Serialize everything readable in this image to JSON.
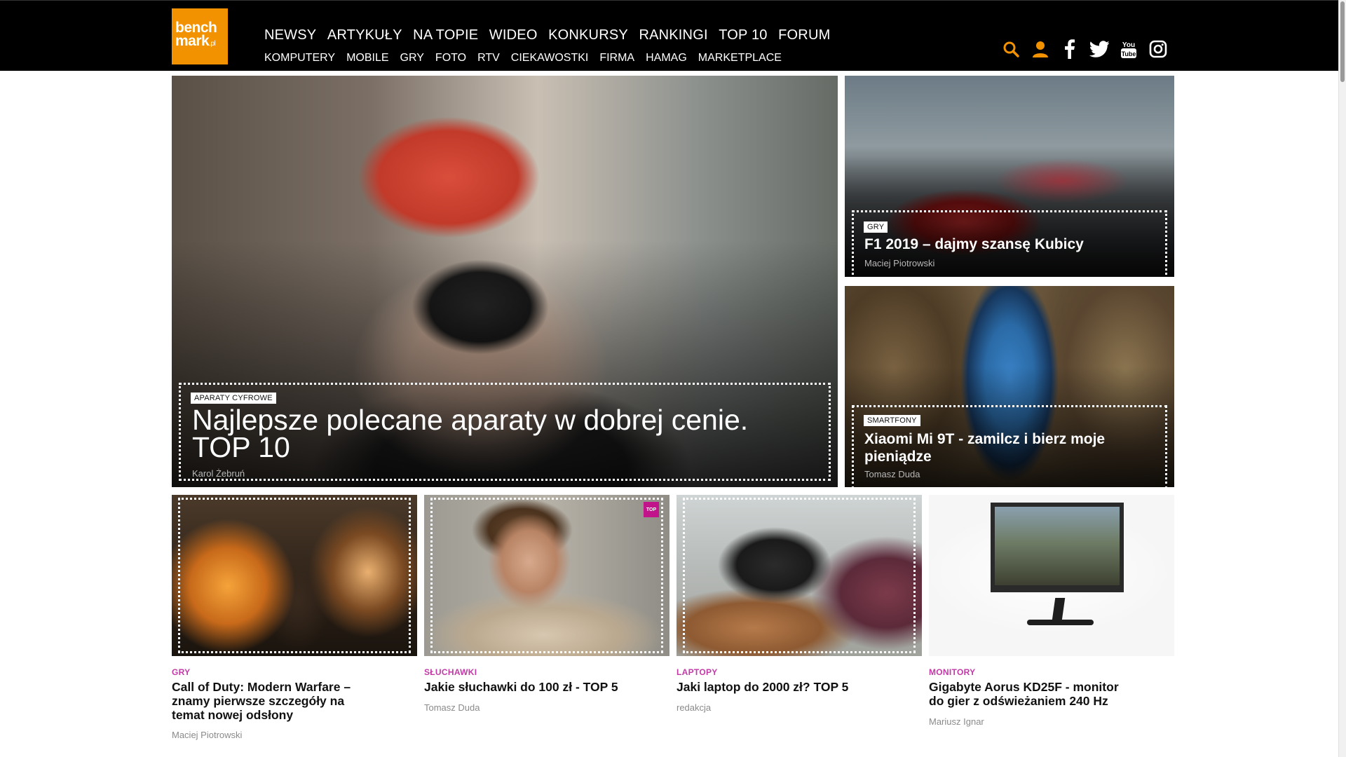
{
  "logo": {
    "line1": "bench",
    "line2": "mark",
    "suffix": ".pl"
  },
  "nav": {
    "main": [
      "NEWSY",
      "ARTYKUŁY",
      "NA TOPIE",
      "WIDEO",
      "KONKURSY",
      "RANKINGI",
      "TOP 10",
      "FORUM"
    ],
    "sub": [
      "KOMPUTERY",
      "MOBILE",
      "GRY",
      "FOTO",
      "RTV",
      "CIEKAWOSTKI",
      "FIRMA",
      "HAMAG",
      "MARKETPLACE"
    ]
  },
  "icons": {
    "accent": "#f39200",
    "names": [
      "search-icon",
      "user-icon",
      "facebook-icon",
      "twitter-icon",
      "youtube-icon",
      "instagram-icon"
    ]
  },
  "hero": {
    "category": "APARATY CYFROWE",
    "title_line1": "Najlepsze polecane aparaty w dobrej cenie.",
    "title_line2": "TOP 10",
    "author": "Karol Żebruń"
  },
  "side_top": {
    "category": "GRY",
    "title": "F1 2019 – dajmy szansę Kubicy",
    "author": "Maciej Piotrowski"
  },
  "side_bottom": {
    "category": "SMARTFONY",
    "title_line1": "Xiaomi Mi 9T - zamilcz i bierz moje",
    "title_line2": "pieniądze",
    "author": "Tomasz Duda"
  },
  "articles": [
    {
      "category": "GRY",
      "title_lines": [
        "Call of Duty: Modern Warfare –",
        "znamy pierwsze szczegóły na",
        "temat nowej odsłony"
      ],
      "author": "Maciej Piotrowski"
    },
    {
      "category": "SŁUCHAWKI",
      "title_lines": [
        "Jakie słuchawki do 100 zł - TOP 5"
      ],
      "author": "Tomasz Duda",
      "badge": "TOP"
    },
    {
      "category": "LAPTOPY",
      "title_lines": [
        "Jaki laptop do 2000 zł? TOP 5"
      ],
      "author": "redakcja"
    },
    {
      "category": "MONITORY",
      "title_lines": [
        "Gigabyte Aorus KD25F - monitor",
        "do gier z odświeżaniem 240 Hz"
      ],
      "author": "Mariusz Ignar"
    }
  ],
  "colors": {
    "category_accent": "#c13aa6",
    "header_bg": "#000000"
  }
}
